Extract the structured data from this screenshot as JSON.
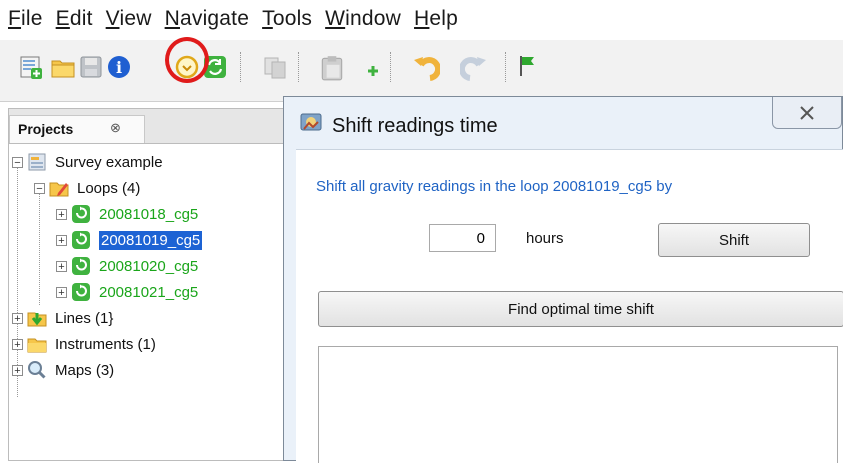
{
  "menubar": {
    "items": [
      {
        "first": "F",
        "rest": "ile"
      },
      {
        "first": "E",
        "rest": "dit"
      },
      {
        "first": "V",
        "rest": "iew"
      },
      {
        "first": "N",
        "rest": "avigate"
      },
      {
        "first": "T",
        "rest": "ools"
      },
      {
        "first": "W",
        "rest": "indow"
      },
      {
        "first": "H",
        "rest": "elp"
      }
    ]
  },
  "toolbar": {
    "icons": [
      "new-project-icon",
      "open-folder-icon",
      "save-icon",
      "info-icon",
      "shift-time-icon",
      "refresh-icon",
      "copy-icon",
      "paste-icon",
      "add-icon",
      "undo-icon",
      "redo-icon",
      "flag-icon"
    ],
    "highlight_color": "#e01b1b"
  },
  "projects_panel": {
    "tab_label": "Projects",
    "close_glyph": "⊗",
    "tree": {
      "root": "Survey example",
      "loops_label": "Loops (4)",
      "loops": [
        "20081018_cg5",
        "20081019_cg5",
        "20081020_cg5",
        "20081021_cg5"
      ],
      "selected_loop_index": 1,
      "lines_label": "Lines (1}",
      "instruments_label": "Instruments (1)",
      "maps_label": "Maps (3)"
    },
    "colors": {
      "loop_text": "#1aa51a",
      "selection": "#1d63d4"
    }
  },
  "dialog": {
    "title": "Shift readings time",
    "message": "Shift all gravity readings in the loop 20081019_cg5 by",
    "hours_value": "0",
    "hours_label": "hours",
    "shift_button": "Shift",
    "optimal_button": "Find optimal time shift",
    "close_glyph": "X"
  }
}
